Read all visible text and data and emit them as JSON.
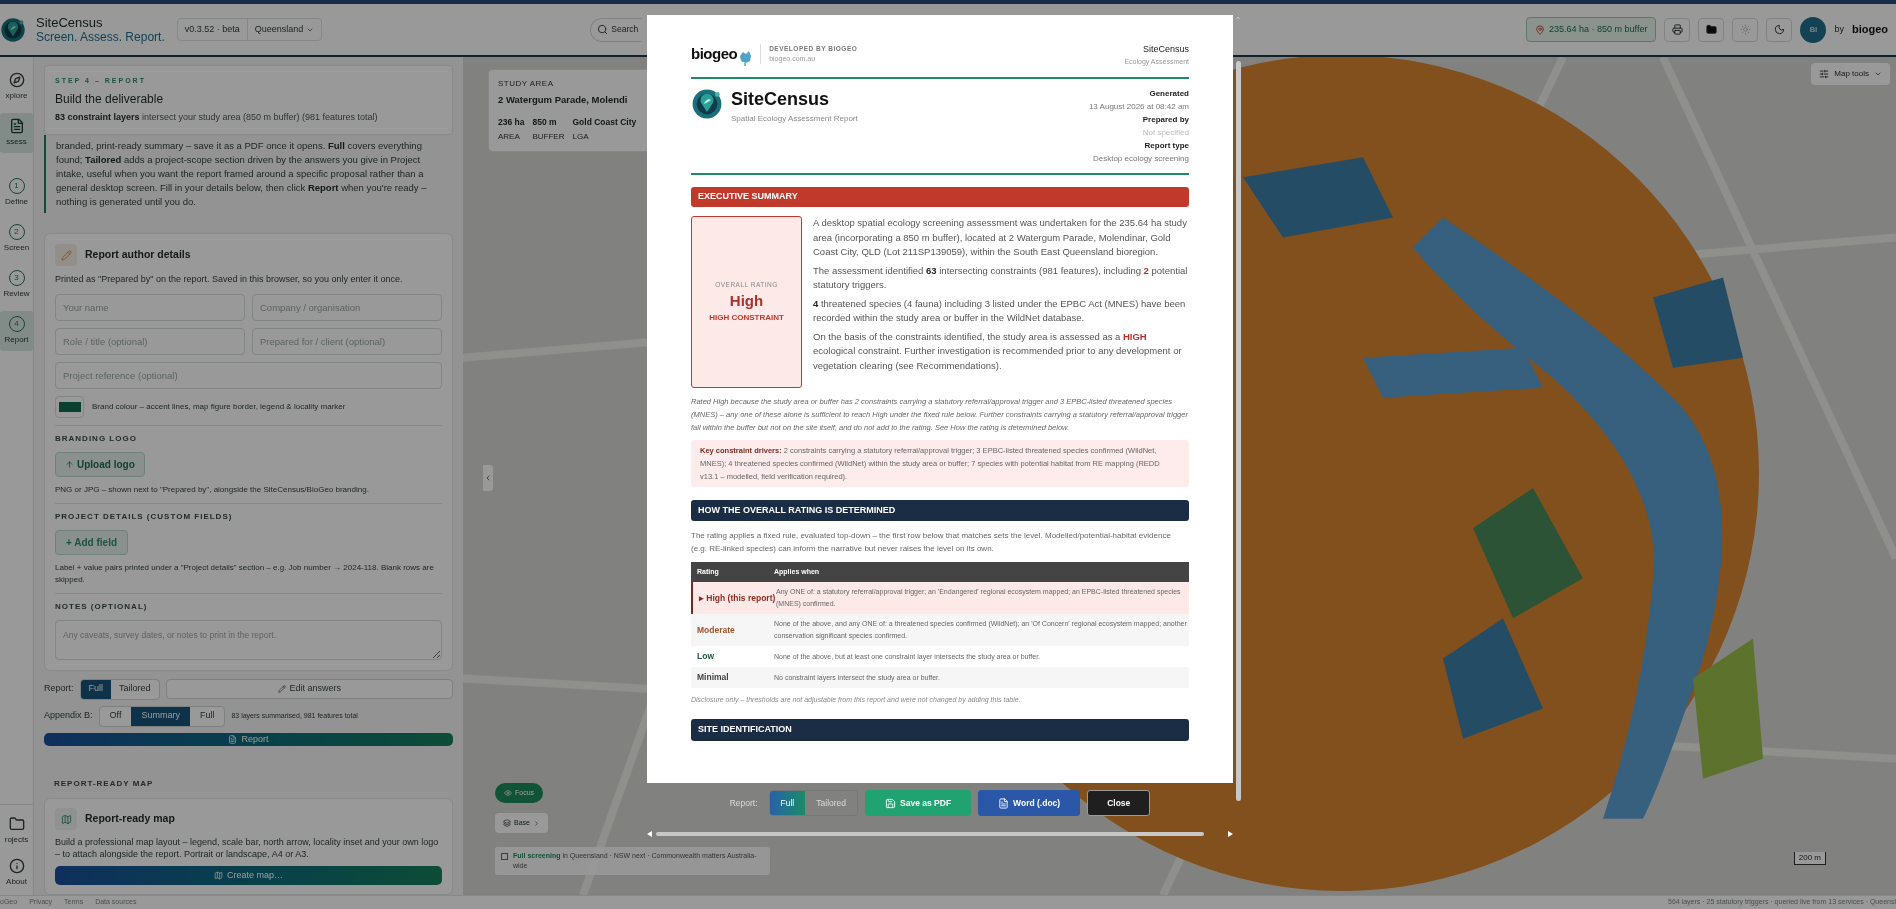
{
  "app_bar": {
    "title": "SiteCensus",
    "tagline": "Screen. Assess. Report.",
    "version": "v0.3.52 · beta",
    "region": "Queensland",
    "search_placeholder": "Search",
    "area_chip": "235.64 ha · 850 m buffer",
    "avatar": "BI",
    "brand_by": "by",
    "brand": "biogeo"
  },
  "rail": {
    "items": [
      {
        "kind": "compass",
        "label": "xplore",
        "selected": false
      },
      {
        "kind": "document",
        "label": "ssess",
        "selected": true
      },
      {
        "kind": "step",
        "number": "1",
        "label": "Define",
        "selected": false
      },
      {
        "kind": "step",
        "number": "2",
        "label": "Screen",
        "selected": false
      },
      {
        "kind": "step",
        "number": "3",
        "label": "Review",
        "selected": false
      },
      {
        "kind": "step",
        "number": "4",
        "label": "Report",
        "selected": true
      }
    ],
    "bottom": [
      {
        "kind": "folder",
        "label": "rojects"
      },
      {
        "kind": "info",
        "label": "About"
      }
    ]
  },
  "panel": {
    "step": {
      "eyebrow": "STEP 4 – REPORT",
      "title": "Build the deliverable",
      "summary": "**83 constraint layers** intersect your study area (850 m buffer) (981 features total)"
    },
    "intro": "branded, print-ready summary – save it as a PDF once it opens. **Full** covers everything found; **Tailored** adds a project-scope section driven by the answers you give in Project intake, useful when you want the report framed around a specific proposal rather than a general desktop screen. Fill in your details below, then click **Report** when you're ready – nothing is generated until you do.",
    "author": {
      "title": "Report author details",
      "note": "Printed as \"Prepared by\" on the report. Saved in this browser, so you only enter it once.",
      "fields": [
        {
          "placeholder": "Your name"
        },
        {
          "placeholder": "Company / organisation"
        },
        {
          "placeholder": "Role / title (optional)"
        },
        {
          "placeholder": "Prepared for / client (optional)"
        },
        {
          "placeholder": "Project reference (optional)"
        }
      ],
      "brand_colour": "Brand colour – accent lines, map figure border, legend & locality marker",
      "logo_heading": "BRANDING LOGO",
      "logo_button": "Upload logo",
      "logo_note": "PNG or JPG – shown next to \"Prepared by\", alongside the SiteCensus/BioGeo branding.",
      "details_heading": "PROJECT DETAILS (CUSTOM FIELDS)",
      "details_button": "+ Add field",
      "details_note": "Label + value pairs printed under a \"Project details\" section – e.g. Job number → 2024-118. Blank rows are skipped.",
      "notes_heading": "NOTES (OPTIONAL)",
      "notes_placeholder": "Any caveats, survey dates, or notes to print in the report."
    },
    "report_mode": {
      "label": "Report:",
      "options": [
        {
          "label": "Full",
          "selected": true
        },
        {
          "label": "Tailored",
          "selected": false
        }
      ],
      "edit": "Edit answers"
    },
    "appendix": {
      "label": "Appendix B:",
      "options": [
        {
          "label": "Off",
          "selected": false
        },
        {
          "label": "Summary",
          "selected": true
        },
        {
          "label": "Full",
          "selected": false
        }
      ],
      "note": "83 layers summarised, 981 features total"
    },
    "report_button": "Report",
    "map_section": {
      "heading": "REPORT-READY MAP",
      "title": "Report-ready map",
      "text": "Build a professional map layout – legend, scale bar, north arrow, locality inset and your own logo – to attach alongside the report. Portrait or landscape, A4 or A3.",
      "button": "Create map…"
    }
  },
  "footer_links": [
    "oGeo",
    "Privacy",
    "Terms",
    "Data sources"
  ],
  "map": {
    "study": {
      "label": "STUDY AREA",
      "address": "2 Watergum Parade, Molendi",
      "stats": [
        {
          "value": "236 ha",
          "label": "AREA"
        },
        {
          "value": "850 m",
          "label": "BUFFER"
        },
        {
          "value": "Gold Coast City",
          "label": "LGA"
        }
      ]
    },
    "tools": "Map tools",
    "focus": "Focus",
    "base": "Base",
    "coverage": "**Full screening** in Queensland · NSW next · Commonwealth matters Australia-wide",
    "scale": "200 m",
    "status": "564 layers · 25 statutory triggers · queried live from 13 services · Queensl"
  },
  "report": {
    "header": {
      "brand": "biogeo",
      "developed": "DEVELOPED BY BIOGEO",
      "url": "biogeo.com.au",
      "product": "SiteCensus",
      "product_sub": "Ecology Assessment"
    },
    "title": "SiteCensus",
    "subtitle": "Spatial Ecology Assessment Report",
    "meta": [
      {
        "label": "Generated",
        "value": "13 August 2026 at 08:42 am",
        "muted": false
      },
      {
        "label": "Prepared by",
        "value": "Not specified",
        "muted": true
      },
      {
        "label": "Report type",
        "value": "Desktop ecology screening",
        "muted": false
      }
    ],
    "summary_heading": "EXECUTIVE SUMMARY",
    "rating": {
      "label": "OVERALL RATING",
      "value": "High",
      "sub": "HIGH CONSTRAINT"
    },
    "paragraphs": [
      [
        {
          "kind": "plain",
          "text": "A desktop spatial ecology screening assessment was undertaken for the 235.64 ha study area (incorporating a 850 m buffer), located at 2 Watergum Parade, Molendinar, Gold Coast City, QLD (Lot 211SP139059), within the South East Queensland bioregion."
        }
      ],
      [
        {
          "kind": "plain",
          "text": "The assessment identified "
        },
        {
          "kind": "bold",
          "text": "63"
        },
        {
          "kind": "plain",
          "text": " intersecting constraints (981 features), including "
        },
        {
          "kind": "alert",
          "text": "2"
        },
        {
          "kind": "plain",
          "text": " potential statutory triggers."
        }
      ],
      [
        {
          "kind": "bold",
          "text": "4"
        },
        {
          "kind": "plain",
          "text": " threatened species (4 fauna) including 3 listed under the EPBC Act (MNES) have been recorded within the study area or buffer in the WildNet database."
        }
      ],
      [
        {
          "kind": "plain",
          "text": "On the basis of the constraints identified, the study area is assessed as a "
        },
        {
          "kind": "alert",
          "text": "HIGH"
        },
        {
          "kind": "plain",
          "text": " ecological constraint. Further investigation is recommended prior to any development or vegetation clearing (see Recommendations)."
        }
      ]
    ],
    "rationale": "Rated High because the study area or buffer has 2 constraints carrying a statutory referral/approval trigger and 3 EPBC-listed threatened species (MNES) – any one of these alone is sufficient to reach High under the fixed rule below. Further constraints carrying a statutory referral/approval trigger fall within the buffer but not on the site itself, and do not add to the rating. See How the rating is determined below.",
    "drivers": "**Key constraint drivers:** 2 constraints carrying a statutory referral/approval trigger; 3 EPBC-listed threatened species confirmed (WildNet, MNES); 4 threatened species confirmed (WildNet) within the study area or buffer; 7 species with potential habitat from RE mapping (REDD v13.1 – modelled, field verification required).",
    "rating_heading": "HOW THE OVERALL RATING IS DETERMINED",
    "rating_intro": "The rating applies a fixed rule, evaluated top-down – the first row below that matches sets the level. Modelled/potential-habitat evidence (e.g. RE-linked species) can inform the narrative but never raises the level on its own.",
    "table": {
      "columns": [
        "Rating",
        "Applies when"
      ],
      "rows": [
        {
          "rating": "▸ High (this report)",
          "color": "#8b2c22",
          "selected": true,
          "applies": "Any ONE of: a statutory referral/approval trigger; an 'Endangered' regional ecosystem mapped; an EPBC-listed threatened species (MNES) confirmed."
        },
        {
          "rating": "Moderate",
          "color": "#a0522d",
          "selected": false,
          "applies": "None of the above, and any ONE of: a threatened species confirmed (WildNet); an 'Of Concern' regional ecosystem mapped; another conservation significant species confirmed."
        },
        {
          "rating": "Low",
          "color": "#1d5a3c",
          "selected": false,
          "applies": "None of the above, but at least one constraint layer intersects the study area or buffer."
        },
        {
          "rating": "Minimal",
          "color": "#444444",
          "selected": false,
          "applies": "No constraint layers intersect the study area or buffer."
        }
      ]
    },
    "disclosure": "Disclosure only – thresholds are not adjustable from this report and were not changed by adding this table.",
    "site_heading": "SITE IDENTIFICATION"
  },
  "modal_bar": {
    "label": "Report:",
    "options": [
      {
        "label": "Full",
        "selected": true
      },
      {
        "label": "Tailored",
        "selected": false
      }
    ],
    "buttons": [
      {
        "kind": "pdf",
        "label": "Save as PDF"
      },
      {
        "kind": "word",
        "label": "Word (.doc)"
      },
      {
        "kind": "close",
        "label": "Close"
      }
    ]
  }
}
